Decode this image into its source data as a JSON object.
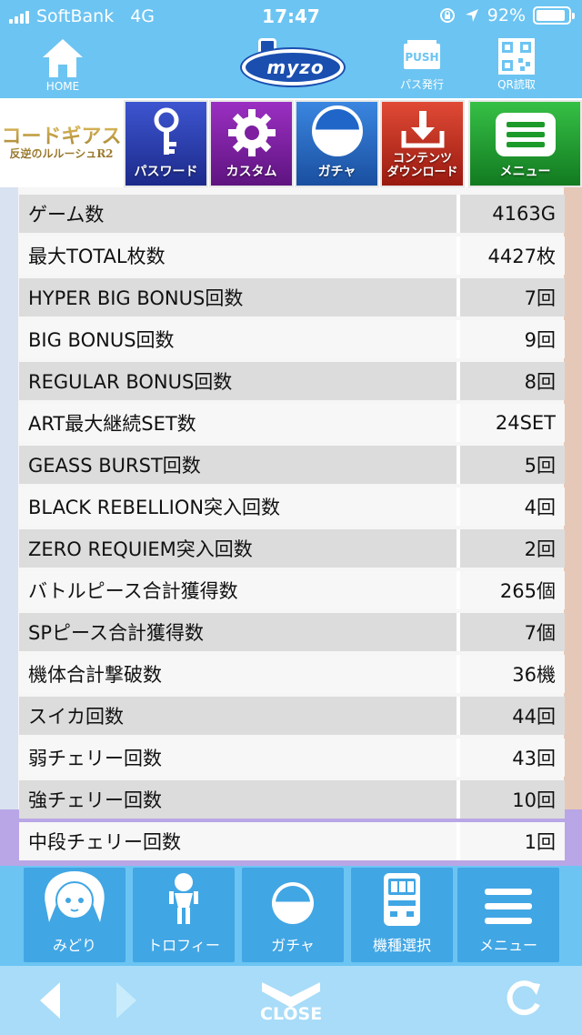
{
  "status": {
    "carrier": "SoftBank",
    "network": "4G",
    "time": "17:47",
    "battery": "92%",
    "battery_level": 0.92
  },
  "header": {
    "home_label": "HOME",
    "logo_text": "myzo",
    "push_text": "PUSH",
    "pass_label": "パス発行",
    "qr_label": "QR読取"
  },
  "nav": {
    "game_logo": [
      "コードギアス",
      "反逆のルルーシュR2"
    ],
    "tiles": [
      {
        "label": "パスワード",
        "color": "#2a3aa8"
      },
      {
        "label": "カスタム",
        "color": "#7d1fa0"
      },
      {
        "label": "ガチャ",
        "color": "#1f66c8"
      },
      {
        "label": "コンテンツダウンロード",
        "label1": "コンテンツ",
        "label2": "ダウンロード",
        "color": "#c02a1e"
      },
      {
        "label": "メニュー",
        "color": "#1c9a2a"
      }
    ]
  },
  "stats": [
    {
      "label": "ゲーム数",
      "value": "4163G"
    },
    {
      "label": "最大TOTAL枚数",
      "value": "4427枚"
    },
    {
      "label": "HYPER BIG BONUS回数",
      "value": "7回"
    },
    {
      "label": "BIG BONUS回数",
      "value": "9回"
    },
    {
      "label": "REGULAR BONUS回数",
      "value": "8回"
    },
    {
      "label": "ART最大継続SET数",
      "value": "24SET"
    },
    {
      "label": "GEASS BURST回数",
      "value": "5回"
    },
    {
      "label": "BLACK REBELLION突入回数",
      "value": "4回"
    },
    {
      "label": "ZERO REQUIEM突入回数",
      "value": "2回"
    },
    {
      "label": "バトルピース合計獲得数",
      "value": "265個"
    },
    {
      "label": "SPピース合計獲得数",
      "value": "7個"
    },
    {
      "label": "機体合計撃破数",
      "value": "36機"
    },
    {
      "label": "スイカ回数",
      "value": "44回"
    },
    {
      "label": "弱チェリー回数",
      "value": "43回"
    },
    {
      "label": "強チェリー回数",
      "value": "10回"
    },
    {
      "label": "中段チェリー回数",
      "value": "1回"
    }
  ],
  "tabbar": {
    "items": [
      {
        "label": "みどり"
      },
      {
        "label": "トロフィー"
      },
      {
        "label": "ガチャ"
      },
      {
        "label": "機種選択"
      },
      {
        "label": "メニュー"
      }
    ]
  },
  "footer": {
    "close_label": "CLOSE"
  },
  "colors": {
    "header_bg": "#6cc4f2",
    "tab_bg": "#41a6e4",
    "footer_bg": "#a8dcf8"
  }
}
